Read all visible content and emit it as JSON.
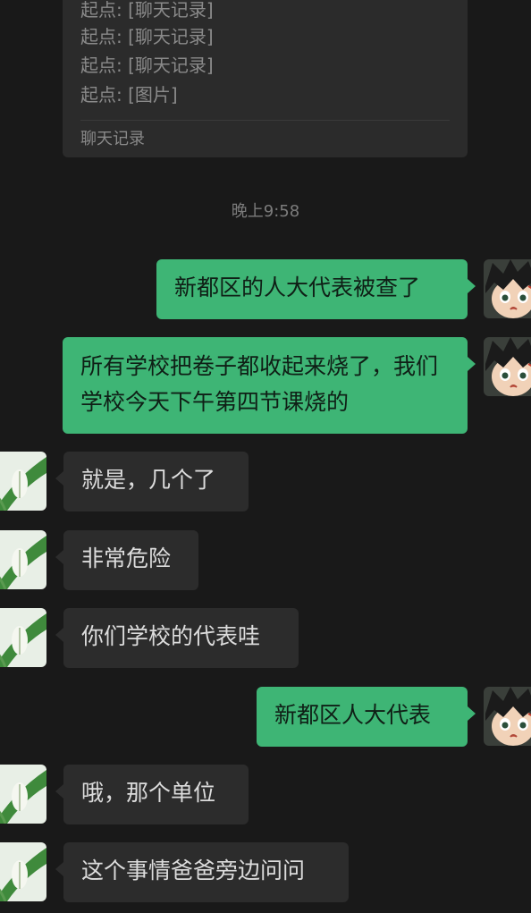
{
  "forward_card": {
    "lines": [
      "起点: [聊天记录]",
      "起点: [聊天记录]",
      "起点: [聊天记录]",
      "起点: [图片]"
    ],
    "footer": "聊天记录"
  },
  "timestamp": "晚上9:58",
  "messages": [
    {
      "side": "sent",
      "text": "新都区的人大代表被查了"
    },
    {
      "side": "sent",
      "text": "所有学校把卷子都收起来烧了，我们学校今天下午第四节课烧的"
    },
    {
      "side": "recv",
      "text": "就是，几个了"
    },
    {
      "side": "recv",
      "text": "非常危险"
    },
    {
      "side": "recv",
      "text": "你们学校的代表哇"
    },
    {
      "side": "sent",
      "text": "新都区人大代表"
    },
    {
      "side": "recv",
      "text": "哦，那个单位"
    },
    {
      "side": "recv",
      "text": "这个事情爸爸旁边问问"
    }
  ],
  "avatars": {
    "me": "anime-boy-avatar",
    "contact": "plant-leaf-avatar"
  }
}
